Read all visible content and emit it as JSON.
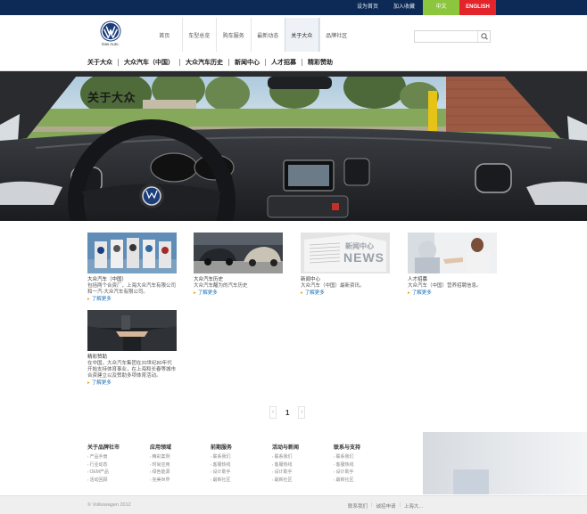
{
  "topbar": {
    "set_home": "设为首页",
    "add_favorite": "加入收藏",
    "lang_cn": "中文",
    "lang_en": "ENGLISH"
  },
  "brand": {
    "tagline": "Das Auto."
  },
  "nav": {
    "items": [
      {
        "label": "首页"
      },
      {
        "label": "车型总览"
      },
      {
        "label": "购车服务"
      },
      {
        "label": "最新动态"
      },
      {
        "label": "关于大众"
      },
      {
        "label": "品牌社区"
      }
    ],
    "active_index": 4
  },
  "search": {
    "placeholder": ""
  },
  "subnav": {
    "items": [
      "关于大众",
      "大众汽车（中国）",
      "大众汽车历史",
      "新闻中心",
      "人才招募",
      "精彩赞助"
    ]
  },
  "hero": {
    "title": "关于大众"
  },
  "cards": [
    {
      "title": "大众汽车（中国）",
      "desc": "包括两个合资厂，上海大众汽车有限公司和一汽-大众汽车有限公司。",
      "more": "了解更多"
    },
    {
      "title": "大众汽车历史",
      "desc": "大众汽车醒为的汽车历史",
      "more": "了解更多"
    },
    {
      "title": "新闻中心",
      "desc": "大众汽车（中国）最新资讯。",
      "more": "了解更多"
    },
    {
      "title": "人才招募",
      "desc": "大众汽车（中国）营养招聘信息。",
      "more": "了解更多"
    },
    {
      "title": "精彩赞助",
      "desc": "在中国，大众汽车集团在20世纪80年代开始支持体育事业，在上海和长春等城市合资建立以及赞助多项体育活动。",
      "more": "了解更多"
    }
  ],
  "news_banner": {
    "line1": "新闻中心",
    "line2": "NEWS"
  },
  "pager": {
    "prev": "‹",
    "current": "1",
    "next": "›"
  },
  "footer_columns": [
    {
      "title": "关于品牌社市",
      "links": [
        "产品手册",
        "行业动态",
        "OEM产品",
        "活动回顾"
      ]
    },
    {
      "title": "应用领域",
      "links": [
        "精彩案例",
        "时尚应用",
        "绿色能源",
        "完美世界"
      ]
    },
    {
      "title": "前期服务",
      "links": [
        "联系我们",
        "客服热线",
        "设计助手",
        "最新社区"
      ]
    },
    {
      "title": "活动与新闻",
      "links": [
        "联系我们",
        "客服热线",
        "设计助手",
        "最新社区"
      ]
    },
    {
      "title": "联系与支持",
      "links": [
        "联系我们",
        "客服热线",
        "设计助手",
        "最新社区"
      ]
    }
  ],
  "footer": {
    "copyright": "© Volkswagen 2012",
    "links": [
      "联系我们",
      "诚招申请",
      "上海大..."
    ]
  },
  "colors": {
    "topbar": "#0c2a55",
    "lang_cn": "#8cc63f",
    "lang_en": "#e3242b",
    "link": "#1a6fb5"
  }
}
